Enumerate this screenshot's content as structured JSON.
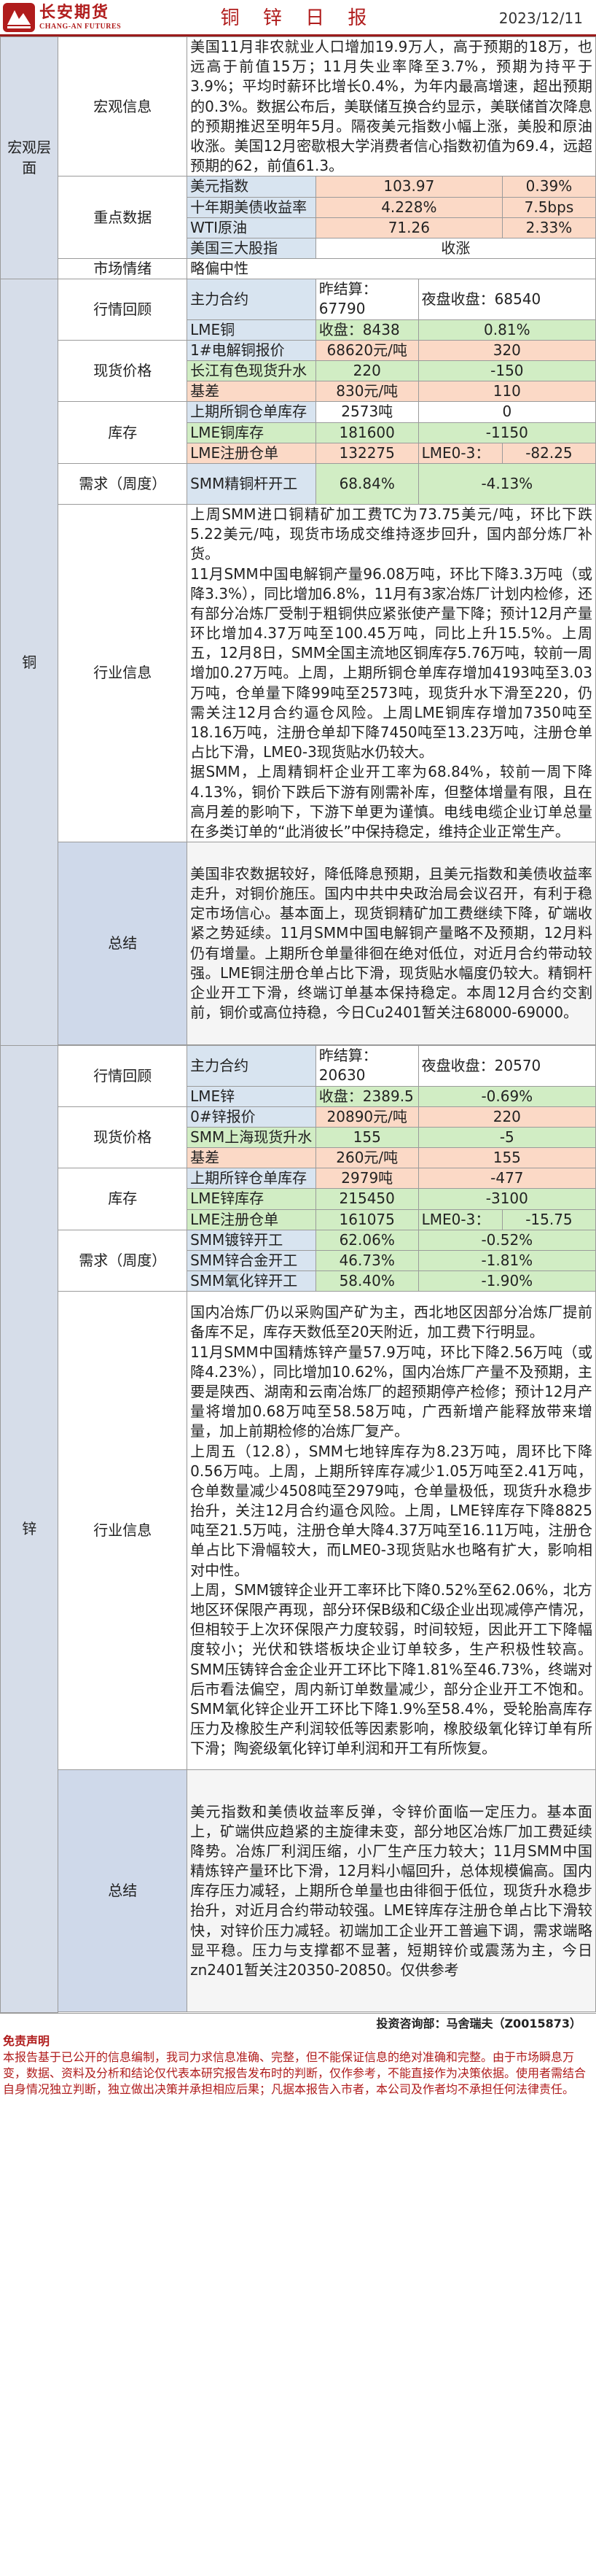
{
  "header": {
    "logo_cn": "长安期货",
    "logo_en": "CHANG-AN FUTURES",
    "title": "铜 锌 日 报",
    "date": "2023/12/11"
  },
  "macro": {
    "section": "宏观层面",
    "info_label": "宏观信息",
    "info_text": "美国11月非农就业人口增加19.9万人，高于预期的18万，也远高于前值15万；11月失业率降至3.7%，预期为持平于3.9%；平均时薪环比增长0.4%，为年内最高增速，超出预期的0.3%。数据公布后，美联储互换合约显示，美联储首次降息的预期推迟至明年5月。隔夜美元指数小幅上涨，美股和原油收涨。美国12月密歇根大学消费者信心指数初值为69.4，远超预期的62，前值61.3。",
    "key_label": "重点数据",
    "key_rows": [
      {
        "name": "美元指数",
        "value": "103.97",
        "change": "0.39%"
      },
      {
        "name": "十年期美债收益率",
        "value": "4.228%",
        "change": "7.5bps"
      },
      {
        "name": "WTI原油",
        "value": "71.26",
        "change": "2.33%"
      },
      {
        "name": "美国三大股指",
        "value": "收涨",
        "change": ""
      }
    ],
    "mood_label": "市场情绪",
    "mood_value": "略偏中性"
  },
  "copper": {
    "section": "铜",
    "review_label": "行情回顾",
    "review_rows": [
      {
        "a": "主力合约",
        "b": "昨结算：67790",
        "c": "夜盘收盘：68540"
      },
      {
        "a": "LME铜",
        "b": "收盘：8438",
        "c": "0.81%"
      }
    ],
    "spot_label": "现货价格",
    "spot_rows": [
      {
        "a": "1#电解铜报价",
        "b": "68620元/吨",
        "c": "320"
      },
      {
        "a": "长江有色现货升水",
        "b": "220",
        "c": "-150"
      },
      {
        "a": "基差",
        "b": "830元/吨",
        "c": "110"
      }
    ],
    "stock_label": "库存",
    "stock_rows": [
      {
        "a": "上期所铜仓单库存",
        "b": "2573吨",
        "c": "0"
      },
      {
        "a": "LME铜库存",
        "b": "181600",
        "c": "-1150"
      },
      {
        "a": "LME注册仓单",
        "b": "132275",
        "c": "LME0-3：",
        "d": "-82.25"
      }
    ],
    "demand_label": "需求（周度）",
    "demand_rows": [
      {
        "a": "SMM精铜杆开工",
        "b": "68.84%",
        "c": "-4.13%"
      }
    ],
    "industry_label": "行业信息",
    "industry_paras": [
      "上周SMM进口铜精矿加工费TC为73.75美元/吨，环比下跌5.22美元/吨，现货市场成交维持逐步回升，国内部分炼厂补货。",
      "11月SMM中国电解铜产量96.08万吨，环比下降3.3万吨（或降3.3%），同比增加6.8%，11月有3家冶炼厂计划内检修，还有部分冶炼厂受制于粗铜供应紧张使产量下降；预计12月产量环比增加4.37万吨至100.45万吨，同比上升15.5%。上周五，12月8日，SMM全国主流地区铜库存5.76万吨，较前一周增加0.27万吨。上周，上期所铜仓单库存增加4193吨至3.03万吨，仓单量下降99吨至2573吨，现货升水下滑至220，仍需关注12月合约逼仓风险。上周LME铜库存增加7350吨至18.16万吨，注册仓单却下降7450吨至13.23万吨，注册仓单占比下滑，LME0-3现货贴水仍较大。",
      "据SMM，上周精铜杆企业开工率为68.84%，较前一周下降4.13%，铜价下跌后下游有刚需补库，但整体增量有限，且在高月差的影响下，下游下单更为谨慎。电线电缆企业订单总量在多类订单的“此消彼长”中保持稳定，维持企业正常生产。"
    ],
    "conclusion_label": "总结",
    "conclusion": "美国非农数据较好，降低降息预期，且美元指数和美债收益率走升，对铜价施压。国内中共中央政治局会议召开，有利于稳定市场信心。基本面上，现货铜精矿加工费继续下降，矿端收紧之势延续。11月SMM中国电解铜产量略不及预期，12月料仍有增量。上期所仓单量徘徊在绝对低位，对近月合约带动较强。LME铜注册仓单占比下滑，现货贴水幅度仍较大。精铜杆企业开工下滑，终端订单基本保持稳定。本周12月合约交割前，铜价或高位持稳，今日Cu2401暂关注68000-69000。"
  },
  "zinc": {
    "section": "锌",
    "review_label": "行情回顾",
    "review_rows": [
      {
        "a": "主力合约",
        "b": "昨结算：20630",
        "c": "夜盘收盘：20570"
      },
      {
        "a": "LME锌",
        "b": "收盘：2389.5",
        "c": "-0.69%"
      }
    ],
    "spot_label": "现货价格",
    "spot_rows": [
      {
        "a": "0#锌报价",
        "b": "20890元/吨",
        "c": "220"
      },
      {
        "a": "SMM上海现货升水",
        "b": "155",
        "c": "-5"
      },
      {
        "a": "基差",
        "b": "260元/吨",
        "c": "155"
      }
    ],
    "stock_label": "库存",
    "stock_rows": [
      {
        "a": "上期所锌仓单库存",
        "b": "2979吨",
        "c": "-477"
      },
      {
        "a": "LME锌库存",
        "b": "215450",
        "c": "-3100"
      },
      {
        "a": "LME注册仓单",
        "b": "161075",
        "c": "LME0-3：",
        "d": "-15.75"
      }
    ],
    "demand_label": "需求（周度）",
    "demand_rows": [
      {
        "a": "SMM镀锌开工",
        "b": "62.06%",
        "c": "-0.52%"
      },
      {
        "a": "SMM锌合金开工",
        "b": "46.73%",
        "c": "-1.81%"
      },
      {
        "a": "SMM氧化锌开工",
        "b": "58.40%",
        "c": "-1.90%"
      }
    ],
    "industry_label": "行业信息",
    "industry_paras": [
      "国内冶炼厂仍以采购国产矿为主，西北地区因部分冶炼厂提前备库不足，库存天数低至20天附近，加工费下行明显。",
      "11月SMM中国精炼锌产量57.9万吨，环比下降2.56万吨（或降4.23%），同比增加10.62%，国内冶炼厂产量不及预期，主要是陕西、湖南和云南冶炼厂的超预期停产检修；预计12月产量将增加0.68万吨至58.58万吨，广西新增产能释放带来增量，加上前期检修的冶炼厂复产。",
      "上周五（12.8），SMM七地锌库存为8.23万吨，周环比下降0.56万吨。上周，上期所锌库存减少1.05万吨至2.41万吨，仓单数量减少4508吨至2979吨，仓单量极低，现货升水稳步抬升，关注12月合约逼仓风险。上周，LME锌库存下降8825吨至21.5万吨，注册仓单大降4.37万吨至16.11万吨，注册仓单占比下滑幅较大，而LME0-3现货贴水也略有扩大，影响相对中性。",
      "上周，SMM镀锌企业开工率环比下降0.52%至62.06%，北方地区环保限产再现，部分环保B级和C级企业出现减停产情况，但相较于上次环保限产力度较弱，时间较短，因此开工下降幅度较小；光伏和铁塔板块企业订单较多，生产积极性较高。SMM压铸锌合金企业开工环比下降1.81%至46.73%，终端对后市看法偏空，周内新订单数量减少，部分企业开工不饱和。SMM氧化锌企业开工环比下降1.9%至58.4%，受轮胎高库存压力及橡胶生产利润较低等因素影响，橡胶级氧化锌订单有所下滑；陶瓷级氧化锌订单利润和开工有所恢复。"
    ],
    "conclusion_label": "总结",
    "conclusion": "美元指数和美债收益率反弹，令锌价面临一定压力。基本面上，矿端供应趋紧的主旋律未变，部分地区冶炼厂加工费延续降势。冶炼厂利润压缩，小厂生产压力较大；11月SMM中国精炼锌产量环比下滑，12月料小幅回升，总体规模偏高。国内库存压力减轻，上期所仓单量也由徘徊于低位，现货升水稳步抬升，对近月合约带动较强。LME锌库存注册仓单占比下滑较快，对锌价压力减轻。初端加工企业开工普遍下调，需求端略显平稳。压力与支撑都不显著，短期锌价或震荡为主，今日zn2401暂关注20350-20850。仅供参考"
  },
  "analyst": "投资咨询部：马舍瑞夫（Z0015873）",
  "disclaimer_title": "免责声明",
  "disclaimer_text": "本报告基于已公开的信息编制，我司力求信息准确、完整，但不能保证信息的绝对准确和完整。由于市场瞬息万变，数据、资料及分析和结论仅代表本研究报告发布时的判断，仅作参考，不能直接作为决策依据。使用者需结合自身情况独立判断，独立做出决策并承担相应后果；凡据本报告入市者，本公司及作者均不承担任何法律责任。"
}
